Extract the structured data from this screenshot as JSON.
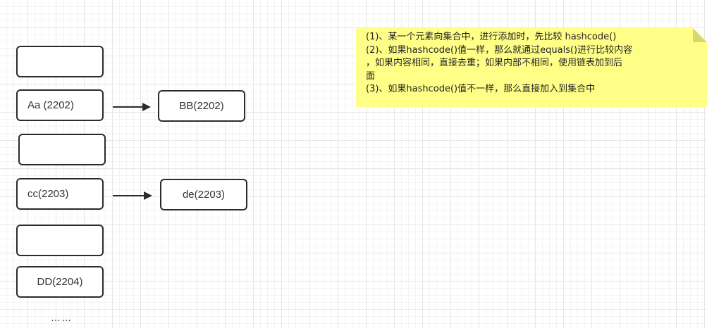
{
  "diagram": {
    "buckets": [
      {
        "key": "bucket-0",
        "label": ""
      },
      {
        "key": "bucket-1",
        "label": "Aa (2202)"
      },
      {
        "key": "bucket-2",
        "label": ""
      },
      {
        "key": "bucket-3",
        "label": "cc(2203)"
      },
      {
        "key": "bucket-4",
        "label": ""
      },
      {
        "key": "bucket-5",
        "label": "DD(2204)"
      }
    ],
    "chain_nodes": [
      {
        "key": "chain-1",
        "label": "BB(2202)"
      },
      {
        "key": "chain-3",
        "label": "de(2203)"
      }
    ],
    "ellipsis": "……",
    "note": {
      "lines": [
        "(1)、某一个元素向集合中，进行添加时，先比较 hashcode()",
        "(2)、如果hashcode()值一样，那么就通过equals()进行比较内容",
        "，如果内容相同，直接去重；如果内部不相同，使用链表加到后",
        "面",
        "(3)、如果hashcode()值不一样，那么直接加入到集合中"
      ],
      "fill_color": "#ffff88",
      "fold_color": "#d8d86a"
    },
    "colors": {
      "stroke": "#2b2b2b",
      "text": "#333333",
      "grid": "#e6e6e6"
    }
  }
}
